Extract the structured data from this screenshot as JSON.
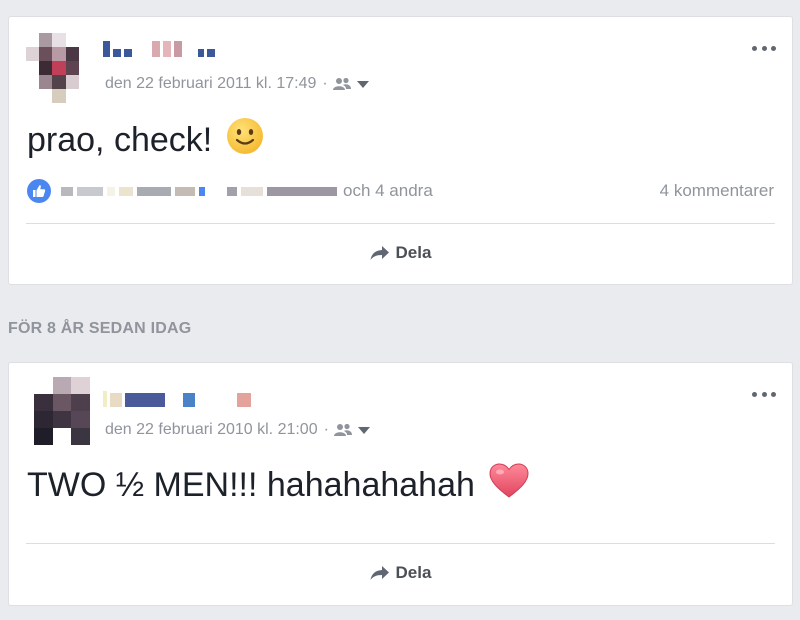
{
  "memories": {
    "header": "FÖR 8 ÅR SEDAN IDAG"
  },
  "posts": [
    {
      "timestamp": "den 22 februari 2011 kl. 17:49",
      "separator": "·",
      "text": "prao, check!",
      "emoji": "slightly-smiling-face",
      "reactions": {
        "others_text": "och 4 andra",
        "comments_text": "4 kommentarer"
      },
      "share_label": "Dela"
    },
    {
      "timestamp": "den 22 februari 2010 kl. 21:00",
      "separator": "·",
      "text": "TWO ½ MEN!!! hahahahahah",
      "emoji": "red-heart",
      "share_label": "Dela"
    }
  ],
  "colors": {
    "like_blue": "#4b87f1",
    "meta_gray": "#90949c",
    "page_background": "#e9ebee"
  }
}
